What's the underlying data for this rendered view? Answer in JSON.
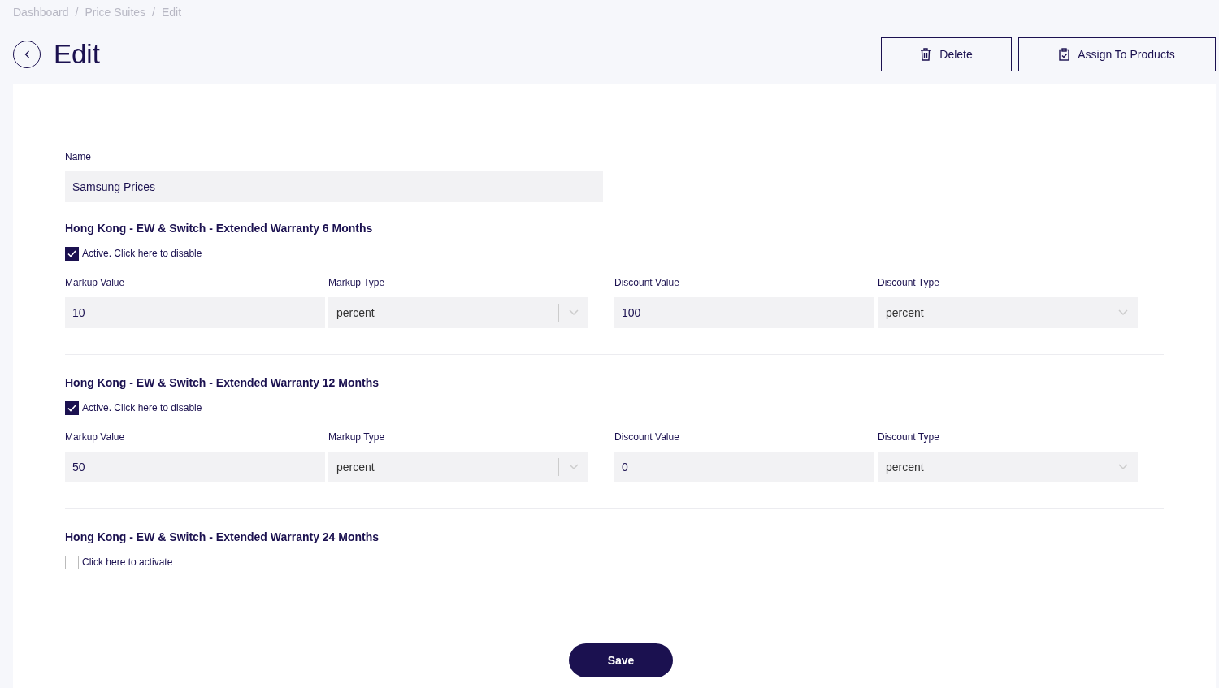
{
  "breadcrumb": {
    "separator": "/",
    "items": [
      "Dashboard",
      "Price Suites",
      "Edit"
    ]
  },
  "title": "Edit",
  "actions": [
    {
      "kind": "delete",
      "label": "Delete"
    },
    {
      "kind": "assign",
      "label": "Assign To Products"
    }
  ],
  "name_field": {
    "label": "Name",
    "value": "Samsung Prices"
  },
  "sections": [
    {
      "title": "Hong Kong - EW & Switch - Extended Warranty 6 Months",
      "checked": true,
      "checkbox_label": "Active. Click here to disable",
      "fields": [
        {
          "kind": "input",
          "label": "Markup Value",
          "value": "10"
        },
        {
          "kind": "select",
          "label": "Markup Type",
          "value": "percent"
        },
        {
          "kind": "input",
          "label": "Discount Value",
          "value": "100"
        },
        {
          "kind": "select",
          "label": "Discount Type",
          "value": "percent"
        }
      ]
    },
    {
      "title": "Hong Kong - EW & Switch - Extended Warranty 12 Months",
      "checked": true,
      "checkbox_label": "Active. Click here to disable",
      "fields": [
        {
          "kind": "input",
          "label": "Markup Value",
          "value": "50"
        },
        {
          "kind": "select",
          "label": "Markup Type",
          "value": "percent"
        },
        {
          "kind": "input",
          "label": "Discount Value",
          "value": "0"
        },
        {
          "kind": "select",
          "label": "Discount Type",
          "value": "percent"
        }
      ]
    },
    {
      "title": "Hong Kong - EW & Switch - Extended Warranty 24 Months",
      "checked": false,
      "checkbox_label": "Click here to activate"
    }
  ],
  "save_button": "Save"
}
